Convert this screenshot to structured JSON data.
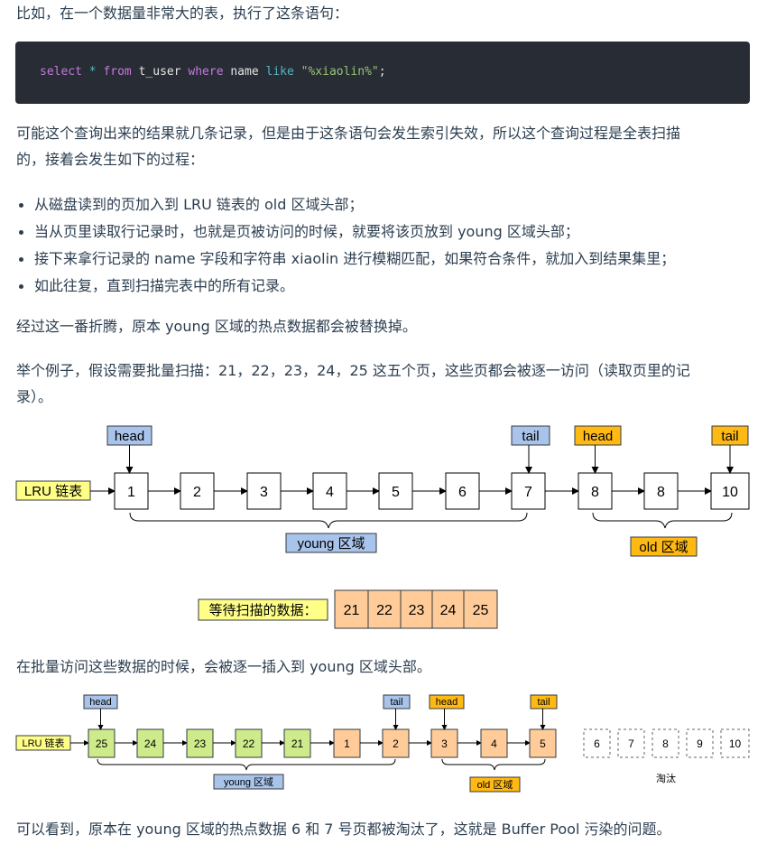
{
  "intro": "比如，在一个数据量非常大的表，执行了这条语句：",
  "code": {
    "kw1": "select",
    "star": "*",
    "kw2": "from",
    "table": "t_user",
    "kw3": "where",
    "col": "name",
    "kw4": "like",
    "pattern": "\"%xiaolin%\"",
    "semi": ";"
  },
  "para1": "可能这个查询出来的结果就几条记录，但是由于这条语句会发生索引失效，所以这个查询过程是全表扫描",
  "para1b": "的，接着会发生如下的过程：",
  "bullets": [
    "从磁盘读到的页加入到 LRU 链表的 old 区域头部；",
    "当从页里读取行记录时，也就是页被访问的时候，就要将该页放到 young 区域头部；",
    "接下来拿行记录的 name 字段和字符串 xiaolin 进行模糊匹配，如果符合条件，就加入到结果集里；",
    "如此往复，直到扫描完表中的所有记录。"
  ],
  "para2": "经过这一番折腾，原本 young 区域的热点数据都会被替换掉。",
  "para3": "举个例子，假设需要批量扫描：21，22，23，24，25 这五个页，这些页都会被逐一访问（读取页里的记",
  "para3b": "录）。",
  "diagram1": {
    "lru_label": "LRU 链表",
    "nodes": [
      "1",
      "2",
      "3",
      "4",
      "5",
      "6",
      "7",
      "8",
      "8",
      "10"
    ],
    "young_head": "head",
    "young_tail": "tail",
    "old_head": "head",
    "old_tail": "tail",
    "young_label": "young 区域",
    "old_label": "old 区域",
    "pending_label": "等待扫描的数据：",
    "pending": [
      "21",
      "22",
      "23",
      "24",
      "25"
    ]
  },
  "para4": "在批量访问这些数据的时候，会被逐一插入到 young 区域头部。",
  "diagram2": {
    "lru_label": "LRU 链表",
    "young_nodes": [
      "25",
      "24",
      "23",
      "22",
      "21",
      "1",
      "2"
    ],
    "old_nodes": [
      "3",
      "4",
      "5"
    ],
    "evicted": [
      "6",
      "7",
      "8",
      "9",
      "10"
    ],
    "evicted_label": "淘汰",
    "young_head": "head",
    "young_tail": "tail",
    "old_head": "head",
    "old_tail": "tail",
    "young_label": "young 区域",
    "old_label": "old 区域"
  },
  "para5": "可以看到，原本在 young 区域的热点数据 6 和 7 号页都被淘汰了，这就是 Buffer Pool 污染的问题。",
  "colors": {
    "blue_label": "#a9c4eb",
    "orange_label": "#ffb914",
    "yellow_label": "#ffff88",
    "green_node": "#cdeb8b",
    "peach_node": "#ffcc99",
    "code_bg": "#282c34"
  }
}
